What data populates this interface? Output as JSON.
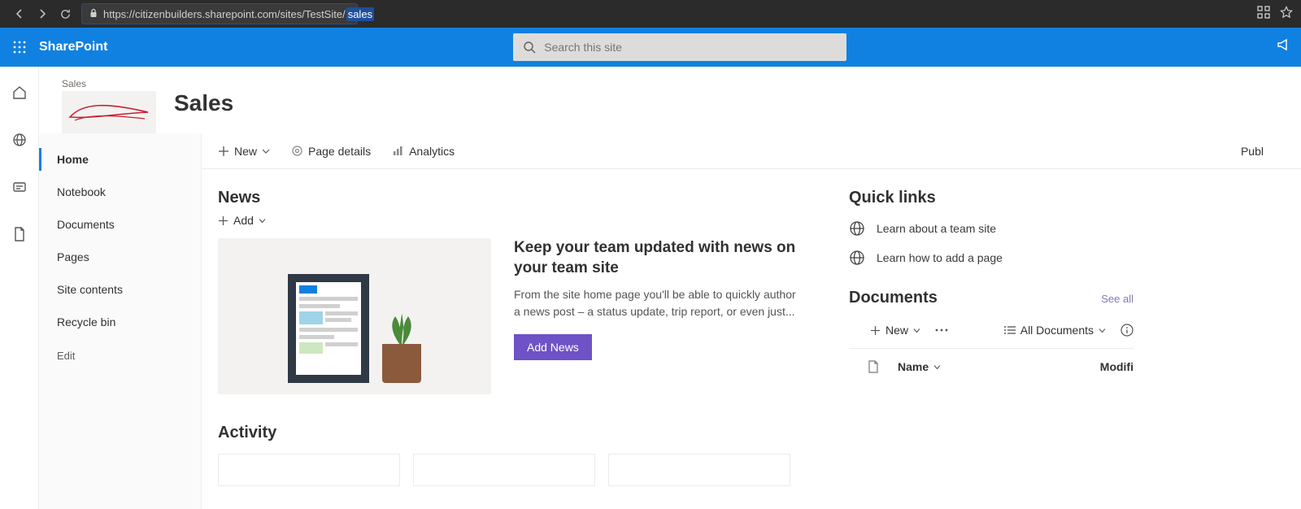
{
  "browser": {
    "url_prefix": "https://citizenbuilders.sharepoint.com/sites/TestSite/",
    "url_highlight": "sales"
  },
  "header": {
    "brand": "SharePoint",
    "search_placeholder": "Search this site"
  },
  "site": {
    "breadcrumb": "Sales",
    "title": "Sales"
  },
  "nav": {
    "items": [
      "Home",
      "Notebook",
      "Documents",
      "Pages",
      "Site contents",
      "Recycle bin"
    ],
    "edit": "Edit"
  },
  "command_bar": {
    "new": "New",
    "page_details": "Page details",
    "analytics": "Analytics",
    "publish": "Publ"
  },
  "news": {
    "title": "News",
    "add": "Add",
    "headline": "Keep your team updated with news on your team site",
    "body": "From the site home page you'll be able to quickly author a news post – a status update, trip report, or even just...",
    "button": "Add News"
  },
  "activity": {
    "title": "Activity"
  },
  "quick_links": {
    "title": "Quick links",
    "items": [
      "Learn about a team site",
      "Learn how to add a page"
    ]
  },
  "documents": {
    "title": "Documents",
    "see_all": "See all",
    "new": "New",
    "view": "All Documents",
    "columns": {
      "name": "Name",
      "modified": "Modifi"
    }
  }
}
